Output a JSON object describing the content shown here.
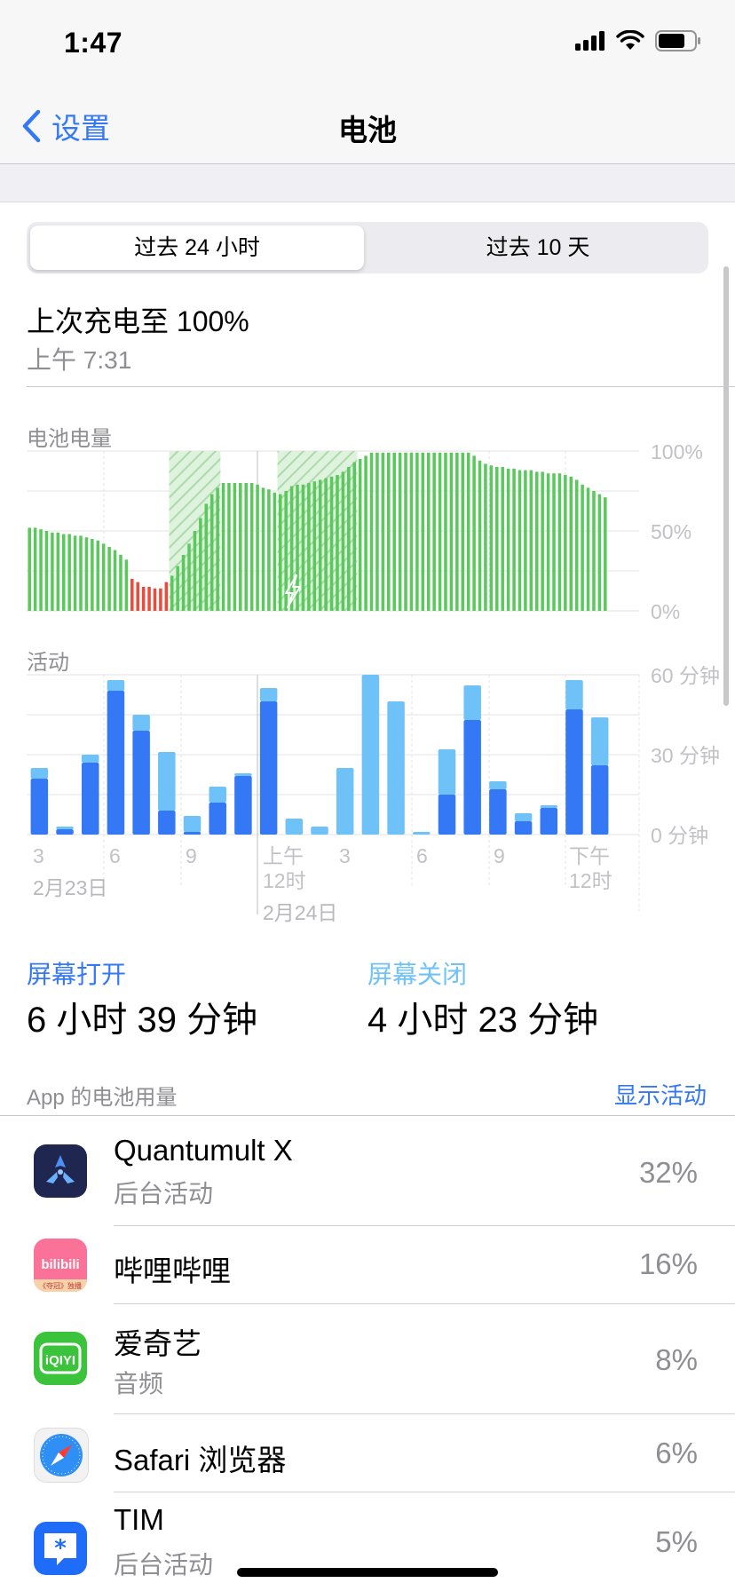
{
  "status": {
    "time": "1:47",
    "icons": [
      "signal-icon",
      "wifi-icon",
      "battery-icon"
    ]
  },
  "nav": {
    "back_label": "设置",
    "title": "电池"
  },
  "segment": {
    "tab1": "过去 24 小时",
    "tab2": "过去 10 天",
    "selected": "过去 24 小时"
  },
  "last_charge": {
    "title": "上次充电至 100%",
    "time": "上午 7:31"
  },
  "colors": {
    "accent": "#3478f6",
    "screen_on": "#3478f6",
    "screen_off": "#6ec2f7",
    "battery_green": "#5ac85c",
    "battery_red": "#eb4a3c"
  },
  "chart_data": [
    {
      "type": "bar",
      "title": "电池电量",
      "ylim": [
        0,
        100
      ],
      "y_ticks": [
        "100%",
        "50%",
        "0%"
      ],
      "values": [
        52,
        52,
        51,
        50,
        49,
        49,
        48,
        48,
        47,
        47,
        46,
        45,
        44,
        42,
        40,
        38,
        35,
        32,
        20,
        18,
        15,
        15,
        14,
        14,
        18,
        22,
        28,
        35,
        42,
        50,
        58,
        67,
        73,
        77,
        80,
        80,
        80,
        80,
        80,
        80,
        79,
        77,
        76,
        74,
        73,
        75,
        78,
        79,
        79,
        80,
        81,
        82,
        83,
        84,
        85,
        87,
        90,
        93,
        95,
        97,
        99,
        99,
        99,
        99,
        99,
        99,
        99,
        99,
        99,
        99,
        99,
        99,
        99,
        99,
        99,
        99,
        99,
        99,
        97,
        94,
        92,
        91,
        90,
        90,
        89,
        89,
        88,
        88,
        88,
        87,
        87,
        86,
        86,
        86,
        85,
        84,
        82,
        79,
        77,
        75,
        73,
        71
      ],
      "low_threshold": 20,
      "charging_ranges": [
        [
          25,
          33
        ],
        [
          44,
          57
        ]
      ]
    },
    {
      "type": "bar",
      "title": "活动",
      "ylim": [
        0,
        60
      ],
      "y_ticks": [
        "60 分钟",
        "30 分钟",
        "0 分钟"
      ],
      "categories": [
        "3",
        "",
        "6",
        "",
        "9",
        "",
        "",
        "",
        "上午 12时",
        "",
        "",
        "3",
        "",
        "",
        "6",
        "",
        "9",
        "",
        "",
        "",
        "下午 12时"
      ],
      "x_ticks": [
        "3",
        "6",
        "9",
        "上午",
        "12时",
        "3",
        "6",
        "9",
        "下午",
        "12时"
      ],
      "dates": [
        "2月23日",
        "2月24日"
      ],
      "series": [
        {
          "name": "屏幕打开",
          "values": [
            21,
            2,
            27,
            54,
            39,
            9,
            1,
            12,
            22,
            50,
            0,
            0,
            0,
            0,
            0,
            0,
            15,
            43,
            17,
            5,
            10,
            47,
            26
          ]
        },
        {
          "name": "屏幕关闭",
          "values": [
            4,
            1,
            3,
            4,
            6,
            22,
            6,
            6,
            1,
            5,
            6,
            3,
            25,
            60,
            50,
            1,
            17,
            13,
            3,
            3,
            1,
            11,
            18
          ]
        }
      ]
    }
  ],
  "screen": {
    "on_label": "屏幕打开",
    "on_value": "6 小时 39 分钟",
    "off_label": "屏幕关闭",
    "off_value": "4 小时 23 分钟"
  },
  "apps": {
    "header": "App 的电池用量",
    "show_activity": "显示活动",
    "items": [
      {
        "name": "Quantumult X",
        "sub": "后台活动",
        "pct": "32%",
        "icon": "quantumult-x-icon"
      },
      {
        "name": "哔哩哔哩",
        "sub": "",
        "pct": "16%",
        "icon": "bilibili-icon",
        "icon_text": "bilibili",
        "icon_sub": "《夺冠》独播"
      },
      {
        "name": "爱奇艺",
        "sub": "音频",
        "pct": "8%",
        "icon": "iqiyi-icon",
        "icon_text": "iQIYI"
      },
      {
        "name": "Safari 浏览器",
        "sub": "",
        "pct": "6%",
        "icon": "safari-icon"
      },
      {
        "name": "TIM",
        "sub": "后台活动",
        "pct": "5%",
        "icon": "tim-icon"
      }
    ]
  }
}
